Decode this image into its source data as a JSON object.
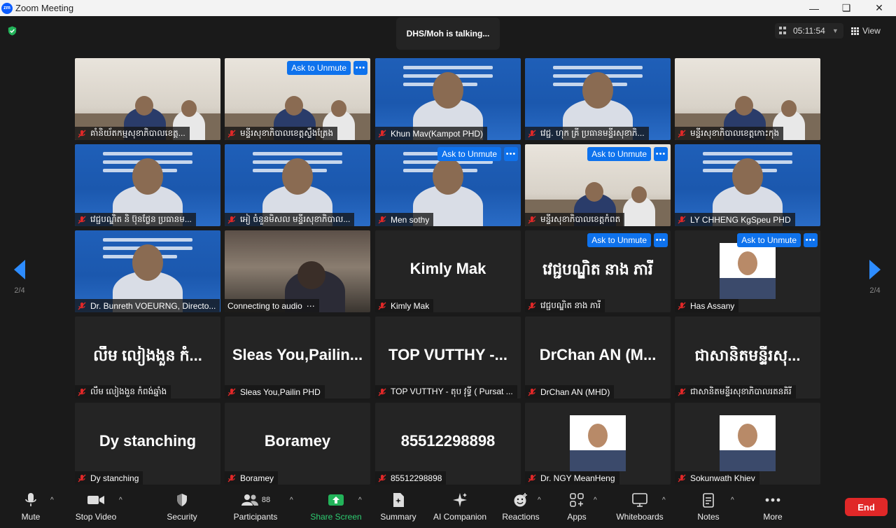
{
  "window": {
    "title": "Zoom Meeting",
    "app_logo": "zm"
  },
  "header": {
    "talking": "DHS/Moh is talking...",
    "timer": "05:11:54",
    "view_label": "View"
  },
  "pager": {
    "left": "2/4",
    "right": "2/4"
  },
  "tiles": [
    {
      "name": "គាំនិយ័តកម្មសុខាភិបាលខេត្ត...",
      "video": true,
      "scene": "office"
    },
    {
      "name": "មន្ទីរសុខាភិបាលខេត្តស្ទឹងត្រែង",
      "video": true,
      "scene": "office",
      "unmute": "Ask to Unmute"
    },
    {
      "name": "Khun Mav(Kampot PHD)",
      "video": true,
      "scene": "blue"
    },
    {
      "name": "វេជ្ជ. ហុក គ្រី ប្រធានមន្ទីរសុខាភិ...",
      "video": true,
      "scene": "blue"
    },
    {
      "name": "មន្ទីរសុខាភិបាលខេត្តកោះកុង",
      "video": true,
      "scene": "office"
    },
    {
      "name": "វេជ្ជបណ្ឌិត និ ប៊ុនថ្លែន ប្រធានម...",
      "video": true,
      "scene": "blue"
    },
    {
      "name": "អៀ ចំនួនមិសល មន្ទីរសុខាភិបាល...",
      "video": true,
      "scene": "blue"
    },
    {
      "name": "Men sothy",
      "video": true,
      "scene": "blue",
      "unmute": "Ask to Unmute"
    },
    {
      "name": "មន្ទីរសុខាភិបាលខេត្តកំពត",
      "video": true,
      "scene": "office",
      "unmute": "Ask to Unmute"
    },
    {
      "name": "LY CHHENG KgSpeu PHD",
      "video": true,
      "scene": "blue"
    },
    {
      "name": "Dr. Bunreth VOEURNG, Directo...",
      "video": true,
      "scene": "blue"
    },
    {
      "name": "Connecting to audio",
      "video": true,
      "scene": "dark",
      "connecting": true
    },
    {
      "name": "Kimly Mak",
      "big": "Kimly Mak"
    },
    {
      "name": "វេជ្ជបណ្ឌិត នាង ភារី",
      "big": "វេជ្ជបណ្ឌិត នាង ភារី",
      "unmute": "Ask to Unmute"
    },
    {
      "name": "Has Assany",
      "photo": true,
      "unmute": "Ask to Unmute"
    },
    {
      "name": "លឹម លៀងងួន កំពង់ឆ្នាំង",
      "big": "លឹម លៀងងួន កំ..."
    },
    {
      "name": "Sleas You,Pailin PHD",
      "big": "Sleas You,Pailin..."
    },
    {
      "name": "TOP VUTTHY - តុប វុទ្ធី ( Pursat ...",
      "big": "TOP VUTTHY -..."
    },
    {
      "name": "DrChan AN (MHD)",
      "big": "DrChan AN (M..."
    },
    {
      "name": "ជាសានិតមន្ទីរសុខាភិបាលរតនគិរី",
      "big": "ជាសានិតមន្ទីរសុ..."
    },
    {
      "name": "Dy stanching",
      "big": "Dy stanching"
    },
    {
      "name": "Boramey",
      "big": "Boramey"
    },
    {
      "name": "85512298898",
      "big": "85512298898"
    },
    {
      "name": "Dr. NGY MeanHeng",
      "photo": true
    },
    {
      "name": "Sokunwath Khiev",
      "photo": true
    }
  ],
  "toolbar": {
    "mute": "Mute",
    "stop_video": "Stop Video",
    "security": "Security",
    "participants": "Participants",
    "participants_count": "88",
    "share_screen": "Share Screen",
    "summary": "Summary",
    "ai_companion": "AI Companion",
    "reactions": "Reactions",
    "apps": "Apps",
    "whiteboards": "Whiteboards",
    "notes": "Notes",
    "more": "More",
    "end": "End"
  },
  "colors": {
    "accent": "#0e72ed",
    "share_green": "#2ecc71",
    "end_red": "#e02828",
    "arrow_blue": "#2d8cff"
  }
}
